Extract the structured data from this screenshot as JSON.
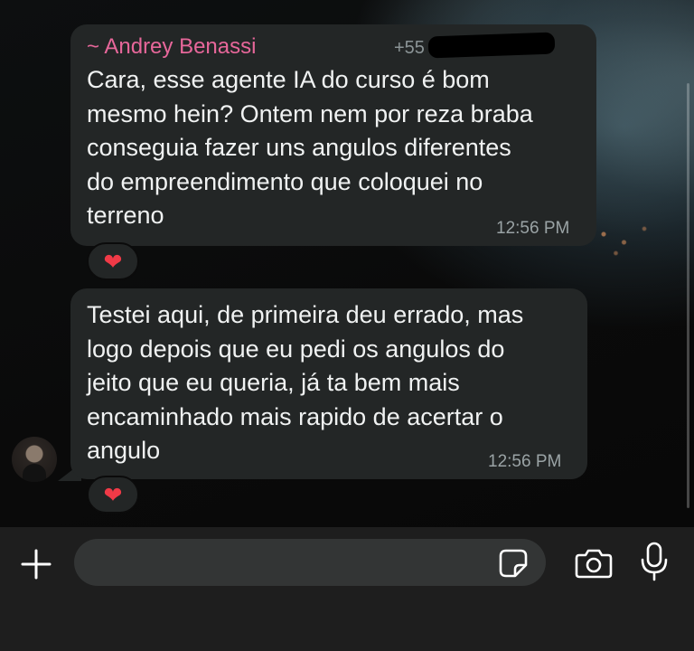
{
  "message_1": {
    "sender": "~ Andrey Benassi",
    "sender_phone": "+55 ·· ····-·····23",
    "text": "Cara, esse agente IA do curso é bom\nmesmo hein? Ontem nem por reza braba\nconseguia fazer uns angulos diferentes\ndo empreendimento que coloquei no\nterreno",
    "time": "12:56 PM",
    "reaction": "❤"
  },
  "message_2": {
    "text": "Testei aqui, de primeira deu errado, mas\nlogo depois que eu pedi os angulos do\njeito que eu queria, já ta bem mais\nencaminhado mais rapido de acertar o\nangulo",
    "time": "12:56 PM",
    "reaction": "❤"
  },
  "composer": {
    "value": ""
  },
  "icons": {
    "add": "plus-icon",
    "sticker": "sticker-icon",
    "camera": "camera-icon",
    "microphone": "microphone-icon"
  },
  "colors": {
    "sender_name": "#e7679a",
    "bubble": "#232626",
    "heart": "#f03a47",
    "input_bar": "#1e1e1e"
  }
}
